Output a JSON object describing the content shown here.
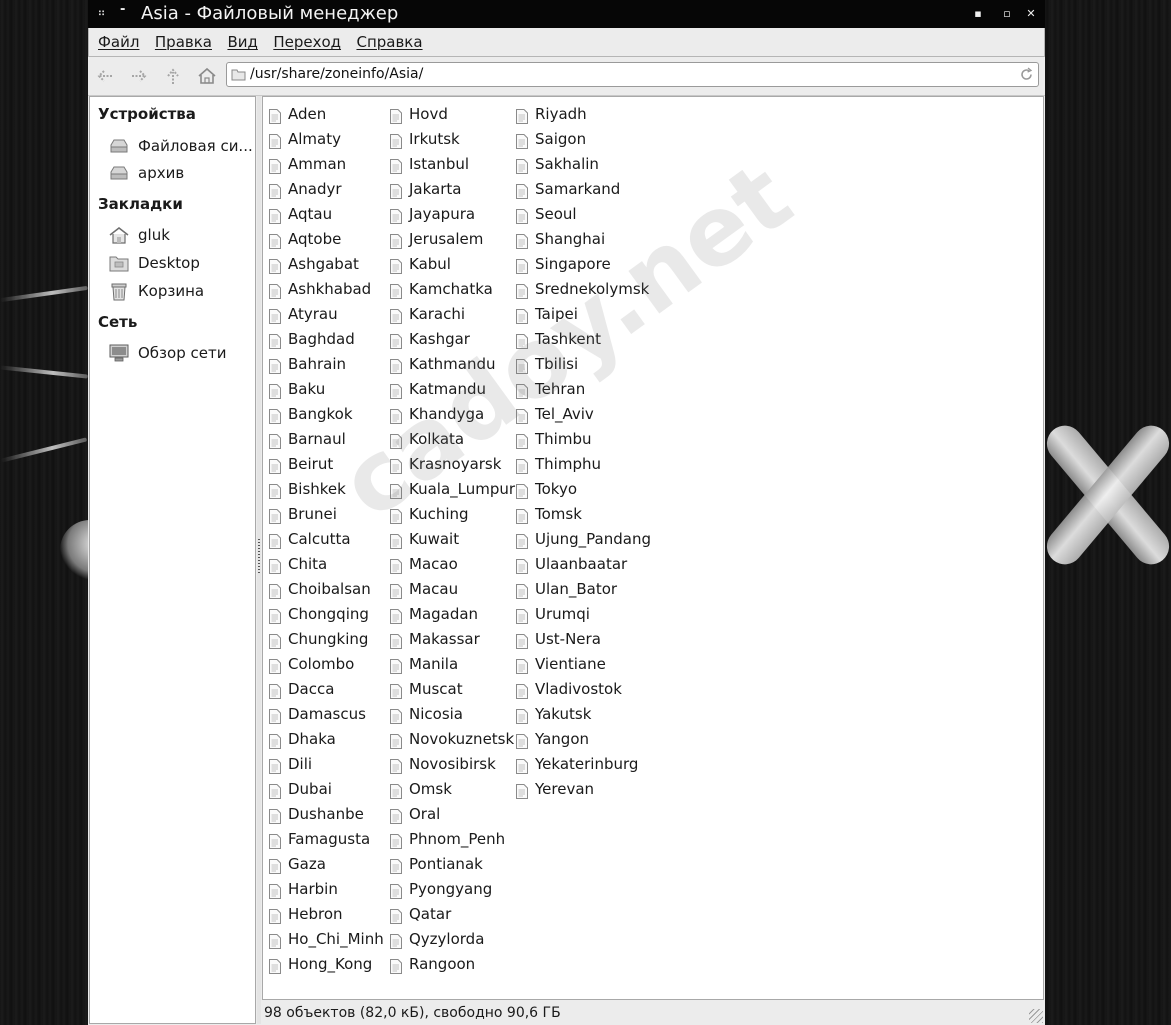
{
  "window": {
    "title": "Asia - Файловый менеджер",
    "controls": {
      "minimize": "▪",
      "maximize": "▫",
      "close": "✕"
    }
  },
  "menubar": {
    "items": [
      "Файл",
      "Правка",
      "Вид",
      "Переход",
      "Справка"
    ]
  },
  "toolbar": {
    "buttons": [
      "back-icon",
      "forward-icon",
      "up-icon",
      "home-icon"
    ],
    "address": "/usr/share/zoneinfo/Asia/"
  },
  "sidebar": {
    "devices_header": "Устройства",
    "devices": [
      "Файловая си...",
      "архив"
    ],
    "bookmarks_header": "Закладки",
    "bookmarks": [
      "gluk",
      "Desktop",
      "Корзина"
    ],
    "network_header": "Сеть",
    "network": [
      "Обзор сети"
    ]
  },
  "files": {
    "columns": [
      [
        "Aden",
        "Almaty",
        "Amman",
        "Anadyr",
        "Aqtau",
        "Aqtobe",
        "Ashgabat",
        "Ashkhabad",
        "Atyrau",
        "Baghdad",
        "Bahrain",
        "Baku",
        "Bangkok",
        "Barnaul",
        "Beirut",
        "Bishkek",
        "Brunei",
        "Calcutta",
        "Chita",
        "Choibalsan",
        "Chongqing",
        "Chungking",
        "Colombo",
        "Dacca",
        "Damascus",
        "Dhaka",
        "Dili",
        "Dubai",
        "Dushanbe",
        "Famagusta",
        "Gaza",
        "Harbin",
        "Hebron",
        "Ho_Chi_Minh",
        "Hong_Kong"
      ],
      [
        "Hovd",
        "Irkutsk",
        "Istanbul",
        "Jakarta",
        "Jayapura",
        "Jerusalem",
        "Kabul",
        "Kamchatka",
        "Karachi",
        "Kashgar",
        "Kathmandu",
        "Katmandu",
        "Khandyga",
        "Kolkata",
        "Krasnoyarsk",
        "Kuala_Lumpur",
        "Kuching",
        "Kuwait",
        "Macao",
        "Macau",
        "Magadan",
        "Makassar",
        "Manila",
        "Muscat",
        "Nicosia",
        "Novokuznetsk",
        "Novosibirsk",
        "Omsk",
        "Oral",
        "Phnom_Penh",
        "Pontianak",
        "Pyongyang",
        "Qatar",
        "Qyzylorda",
        "Rangoon"
      ],
      [
        "Riyadh",
        "Saigon",
        "Sakhalin",
        "Samarkand",
        "Seoul",
        "Shanghai",
        "Singapore",
        "Srednekolymsk",
        "Taipei",
        "Tashkent",
        "Tbilisi",
        "Tehran",
        "Tel_Aviv",
        "Thimbu",
        "Thimphu",
        "Tokyo",
        "Tomsk",
        "Ujung_Pandang",
        "Ulaanbaatar",
        "Ulan_Bator",
        "Urumqi",
        "Ust-Nera",
        "Vientiane",
        "Vladivostok",
        "Yakutsk",
        "Yangon",
        "Yekaterinburg",
        "Yerevan"
      ]
    ]
  },
  "watermark": "cadoy.net",
  "status": "98 объектов (82,0 кБ), свободно 90,6 ГБ"
}
